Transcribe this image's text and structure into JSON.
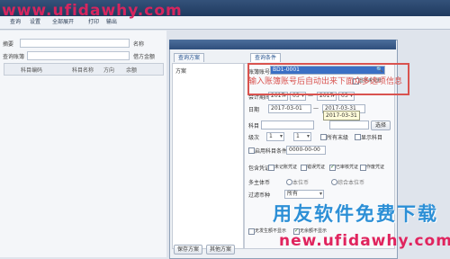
{
  "watermark": {
    "top_url": "www.ufidawhy.com",
    "bottom_cn": "用友软件免费下载",
    "bottom_url": "new.ufidawhy.com"
  },
  "toolbar": {
    "items": [
      "查询",
      "设置",
      "全部展开",
      "打印",
      "输出"
    ]
  },
  "left_panel": {
    "labels": [
      "摘要",
      "名称",
      "查询账簿",
      "借方金额",
      "余额"
    ],
    "grid_headers": [
      "科目编码",
      "科目名称",
      "方向",
      "余额"
    ]
  },
  "dialog": {
    "tabs": [
      "查询方案",
      "查询条件"
    ],
    "tree_root": "方案",
    "account_book_label": "账簿账号",
    "account_book_value": "BD1-0001",
    "red_note": "输入账簿账号后自动出来下面众多选项信息",
    "show_all_checkbox": "显示未记账",
    "period_label": "会计期间",
    "period_from_year": "2017",
    "period_from_month": "03",
    "period_to_year": "2017",
    "period_to_month": "03",
    "date_label": "日期",
    "date_from": "2017-03-01",
    "date_to": "2017-03-31",
    "tooltip": "2017-03-31",
    "subject_label": "科目",
    "subject_level_label": "级次",
    "level_from": "1",
    "level_to": "1",
    "level_end_label": "所有末级",
    "show_all_label": "显示科目",
    "search_btn": "选择",
    "subject_filter_label": "启用科目条件",
    "subject_filter_value": "0000-00-00",
    "voucher_label": "包含凭证",
    "voucher_options": [
      "未记账凭证",
      "错误凭证",
      "已审核凭证",
      "作废凭证"
    ],
    "currency_label": "多主体币",
    "currency_options": [
      "本位币",
      "综合本位币"
    ],
    "format_label": "过滤币种",
    "format_value": "所有",
    "bottom_options": [
      "无发生额不显示",
      "无余额不显示"
    ],
    "buttons": {
      "save": "保存方案",
      "other": "其他方案"
    }
  }
}
